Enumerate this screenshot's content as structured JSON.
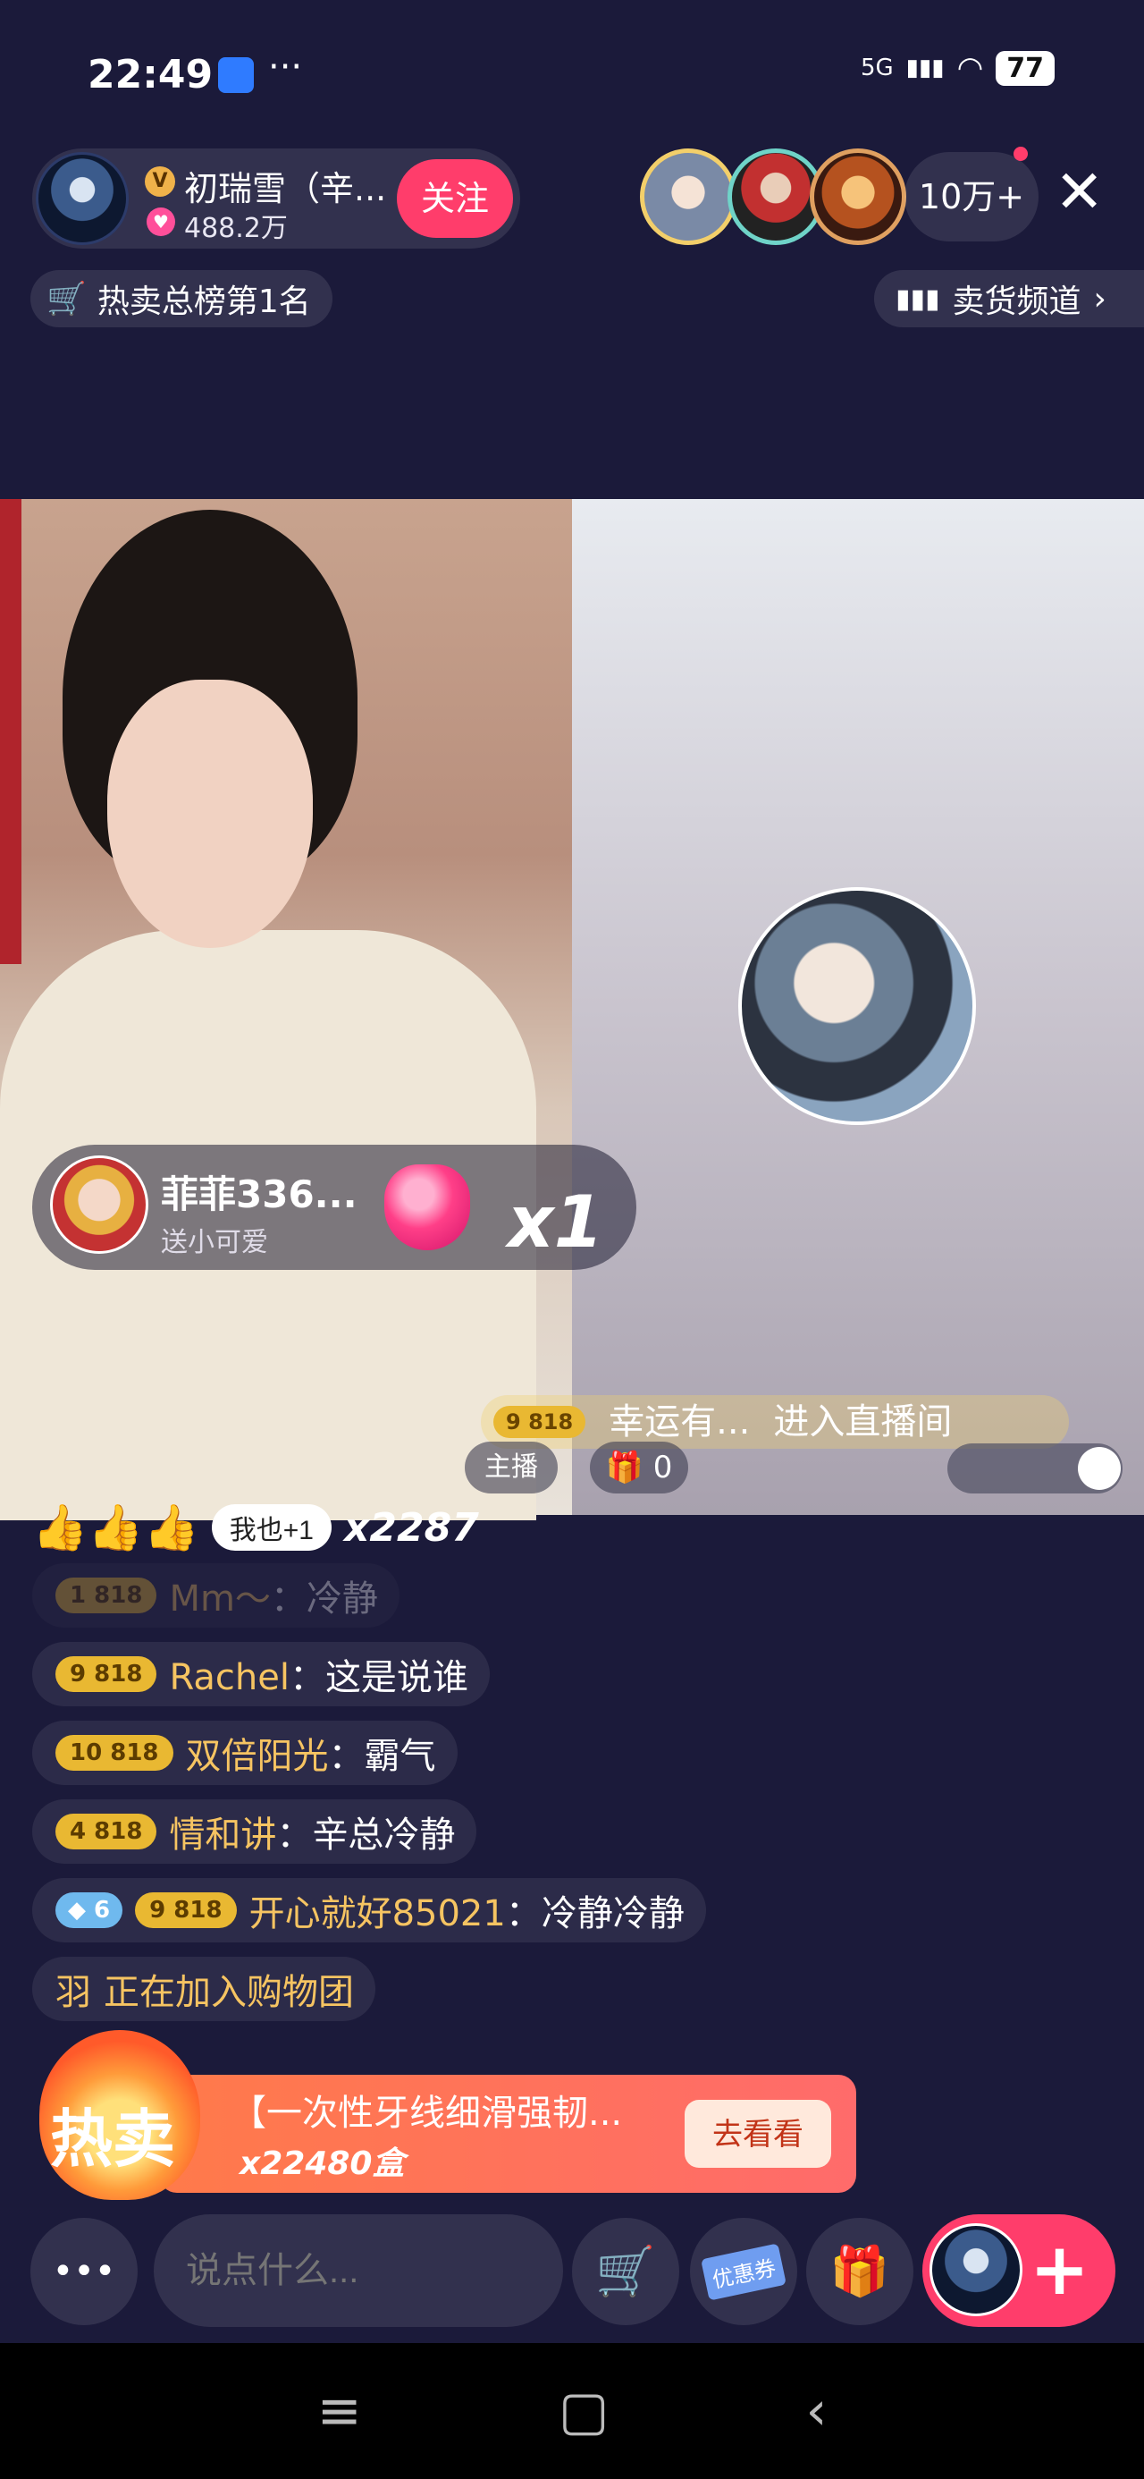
{
  "status_bar": {
    "time": "22:49",
    "dots": "···",
    "network": "5G",
    "battery": "77"
  },
  "host": {
    "name": "初瑞雪（辛...",
    "likes": "488.2万",
    "follow_label": "关注",
    "verified": "V"
  },
  "viewers": {
    "count": "10万+"
  },
  "rank": {
    "label": "热卖总榜第1名"
  },
  "channel": {
    "label": "卖货频道"
  },
  "gift_banner": {
    "user": "菲菲336...",
    "action": "送小可爱",
    "count": "x1"
  },
  "lucky": {
    "level": "9",
    "badge": "818",
    "text": "幸运有...",
    "enter": "进入直播间"
  },
  "tags": {
    "host": "主播",
    "gift_count": "0"
  },
  "likes_row": {
    "emojis": "👍👍👍",
    "button": "我也+1",
    "count": "x2287"
  },
  "chat": [
    {
      "level": "1",
      "badge": "818",
      "user": "Mm～",
      "msg": "冷静"
    },
    {
      "level": "9",
      "badge": "818",
      "user": "Rachel",
      "msg": "这是说谁"
    },
    {
      "level": "10",
      "badge": "818",
      "user": "双倍阳光",
      "msg": "霸气"
    },
    {
      "level": "4",
      "badge": "818",
      "user": "情和讲",
      "msg": "辛总冷静"
    },
    {
      "diamond": "6",
      "level": "9",
      "badge": "818",
      "user": "开心就好85021",
      "msg": "冷静冷静"
    }
  ],
  "join_msg": {
    "user": "羽",
    "text": "正在加入购物团"
  },
  "promo": {
    "hot": "热卖",
    "title": "【一次性牙线细滑强韧...",
    "qty": "x22480盒",
    "button": "去看看"
  },
  "bottom": {
    "placeholder": "说点什么...",
    "more": "•••",
    "coupon": "优惠券"
  },
  "colors": {
    "background": "#1b1a3a",
    "accent": "#ff3d6b",
    "gold": "#f6c462"
  }
}
